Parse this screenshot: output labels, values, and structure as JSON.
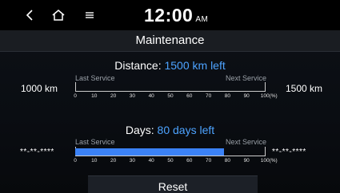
{
  "statusbar": {
    "time": "12:00",
    "ampm": "AM"
  },
  "title": "Maintenance",
  "distance": {
    "heading_label": "Distance:",
    "heading_value": "1500 km left",
    "left_value": "1000 km",
    "right_value": "1500 km",
    "last_service_label": "Last Service",
    "next_service_label": "Next Service",
    "progress_percent": 0
  },
  "days": {
    "heading_label": "Days:",
    "heading_value": "80 days left",
    "left_value": "**-**-****",
    "right_value": "**-**-****",
    "last_service_label": "Last Service",
    "next_service_label": "Next Service",
    "progress_percent": 78
  },
  "scale_ticks": [
    "0",
    "10",
    "20",
    "30",
    "40",
    "50",
    "60",
    "70",
    "80",
    "90",
    "100(%)"
  ],
  "reset_label": "Reset",
  "colors": {
    "accent": "#4da3ff",
    "bar_fill": "#3b82f6"
  },
  "icons": {
    "back": "chevron-left-icon",
    "home": "home-icon",
    "menu": "menu-icon"
  }
}
